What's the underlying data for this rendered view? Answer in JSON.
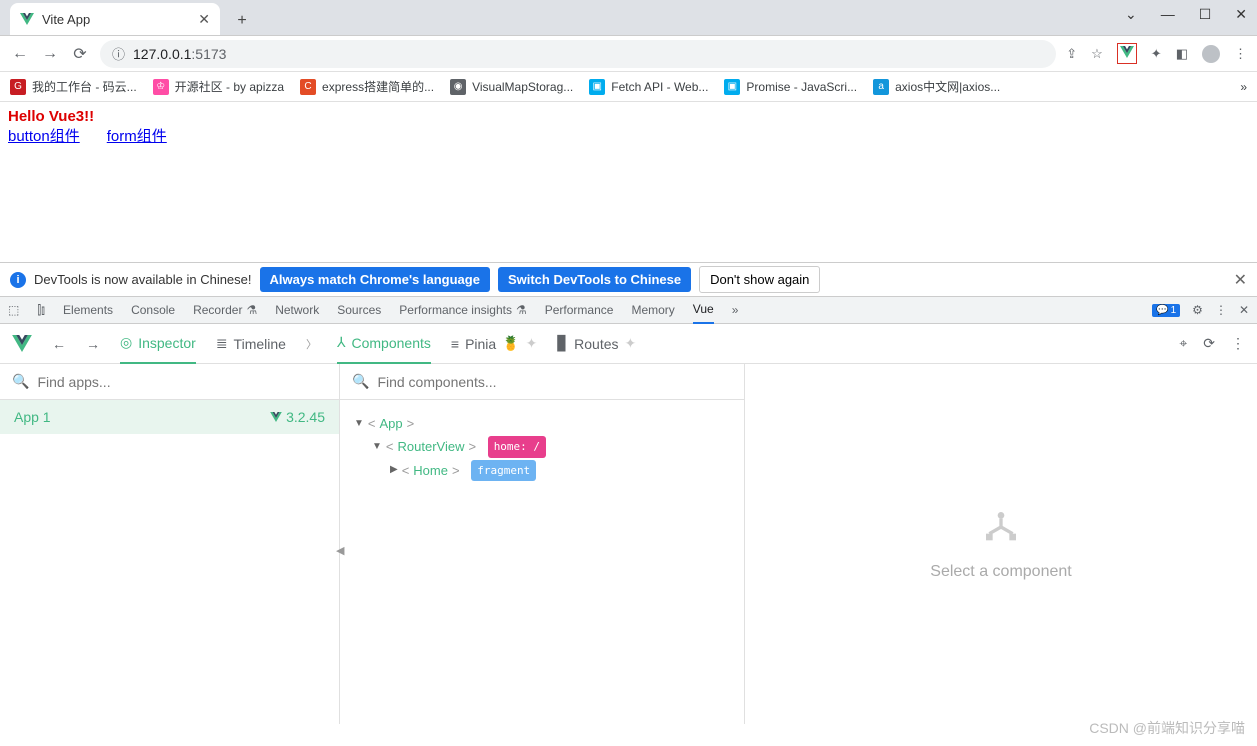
{
  "window": {
    "tab_title": "Vite App",
    "url_display": "127.0.0.1",
    "url_port": ":5173"
  },
  "bookmarks": [
    {
      "label": "我的工作台 - 码云...",
      "color": "#c71d23",
      "glyph": "G"
    },
    {
      "label": "开源社区 - by apizza",
      "color": "#ff6a00",
      "glyph": "♔"
    },
    {
      "label": "express搭建简单的...",
      "color": "#e34c26",
      "glyph": "C"
    },
    {
      "label": "VisualMapStorag...",
      "color": "#5f6368",
      "glyph": "◉"
    },
    {
      "label": "Fetch API - Web...",
      "color": "#00acee",
      "glyph": "▣"
    },
    {
      "label": "Promise - JavaScri...",
      "color": "#00acee",
      "glyph": "▣"
    },
    {
      "label": "axios中文网|axios...",
      "color": "#1296db",
      "glyph": "a"
    }
  ],
  "page": {
    "hello": "Hello Vue3!!",
    "link1": "button组件",
    "link2": "form组件"
  },
  "devtools_notice": {
    "text": "DevTools is now available in Chinese!",
    "btn1": "Always match Chrome's language",
    "btn2": "Switch DevTools to Chinese",
    "btn3": "Don't show again"
  },
  "devtools_tabs": {
    "items": [
      "Elements",
      "Console",
      "Recorder",
      "Network",
      "Sources",
      "Performance insights",
      "Performance",
      "Memory",
      "Vue"
    ],
    "active": "Vue",
    "msg_count": "1"
  },
  "vdt": {
    "nav": {
      "inspector": "Inspector",
      "timeline": "Timeline",
      "components": "Components",
      "pinia": "Pinia",
      "routes": "Routes"
    },
    "left": {
      "search_placeholder": "Find apps...",
      "app_name": "App 1",
      "app_version": "3.2.45"
    },
    "mid": {
      "search_placeholder": "Find components...",
      "tree": {
        "n0": "App",
        "n1": "RouterView",
        "n1_badge": "home: /",
        "n2": "Home",
        "n2_badge": "fragment"
      }
    },
    "right": {
      "prompt": "Select a component"
    }
  },
  "watermark": "CSDN @前端知识分享喵"
}
